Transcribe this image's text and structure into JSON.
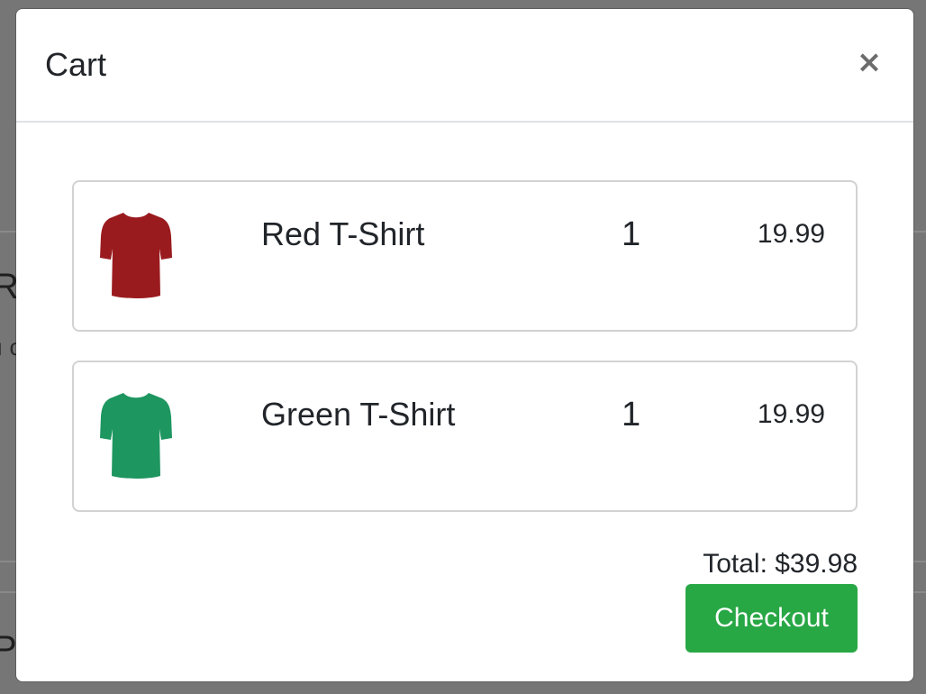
{
  "background_page": {
    "heading_fragment": "Re",
    "text_fragment": "ı c",
    "heading_fragment_2": "Pu"
  },
  "modal": {
    "title": "Cart",
    "close_label": "×",
    "items": [
      {
        "name": "Red T-Shirt",
        "quantity": "1",
        "price": "19.99",
        "image_color": "#9a1b1e",
        "image": "t-shirt-icon"
      },
      {
        "name": "Green T-Shirt",
        "quantity": "1",
        "price": "19.99",
        "image_color": "#1e9660",
        "image": "t-shirt-icon"
      }
    ],
    "total_label": "Total: $39.98",
    "checkout_label": "Checkout"
  },
  "colors": {
    "checkout_button": "#28a745",
    "backdrop": "#767676"
  }
}
